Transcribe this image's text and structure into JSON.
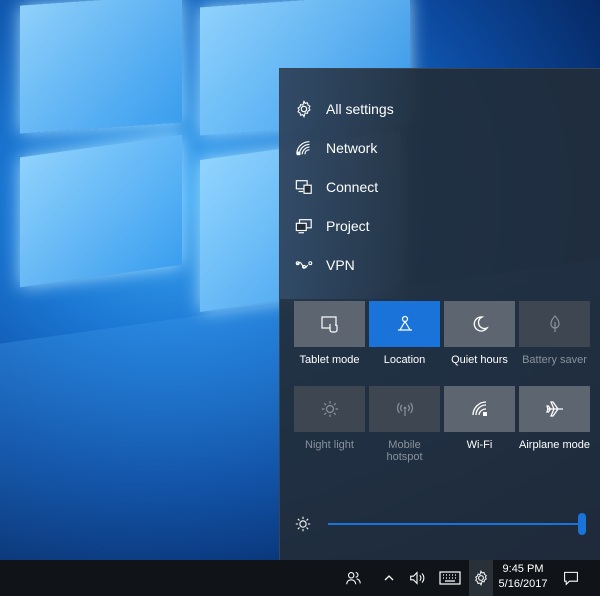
{
  "quick_links": [
    {
      "label": "All settings",
      "icon": "gear-icon"
    },
    {
      "label": "Network",
      "icon": "network-icon"
    },
    {
      "label": "Connect",
      "icon": "connect-icon"
    },
    {
      "label": "Project",
      "icon": "project-icon"
    },
    {
      "label": "VPN",
      "icon": "vpn-icon"
    }
  ],
  "tiles": [
    {
      "label": "Tablet mode",
      "icon": "tablet-mode-icon",
      "state": "off"
    },
    {
      "label": "Location",
      "icon": "location-icon",
      "state": "on"
    },
    {
      "label": "Quiet hours",
      "icon": "moon-icon",
      "state": "off"
    },
    {
      "label": "Battery saver",
      "icon": "battery-saver-icon",
      "state": "disabled"
    },
    {
      "label": "Night light",
      "icon": "night-light-icon",
      "state": "disabled"
    },
    {
      "label": "Mobile hotspot",
      "icon": "mobile-hotspot-icon",
      "state": "disabled"
    },
    {
      "label": "Wi-Fi",
      "icon": "wifi-icon",
      "state": "off"
    },
    {
      "label": "Airplane mode",
      "icon": "airplane-icon",
      "state": "off"
    }
  ],
  "brightness": {
    "level": 1.0,
    "icon": "brightness-icon"
  },
  "taskbar": {
    "icons": [
      "people-icon",
      "chevron-up-icon",
      "volume-icon",
      "keyboard-icon",
      "gear-icon",
      "notification-icon"
    ],
    "time": "9:45 PM",
    "date": "5/16/2017"
  },
  "colors": {
    "accent": "#1a73d9",
    "panel": "#222c3a",
    "tile": "#5d6670",
    "taskbar": "#101418"
  }
}
